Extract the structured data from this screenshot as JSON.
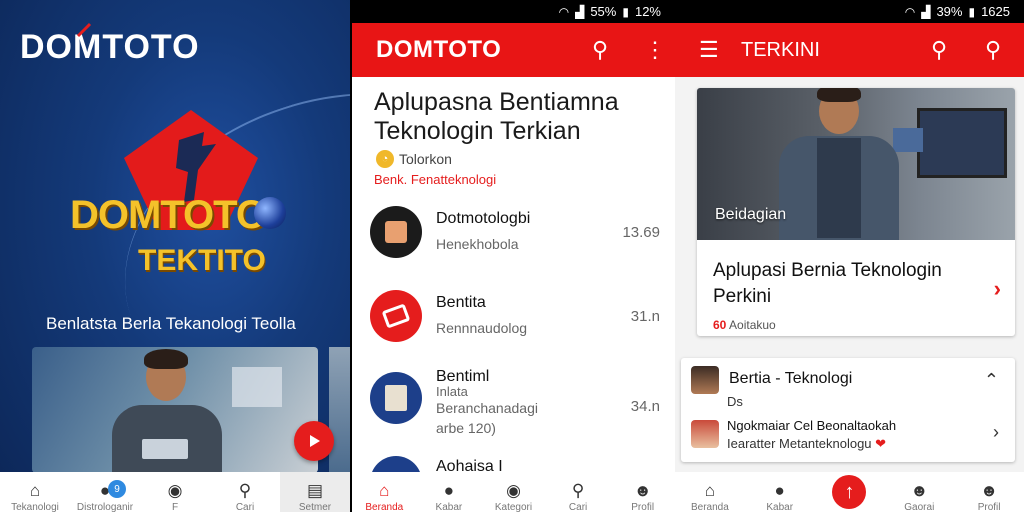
{
  "splash": {
    "logo_text": "DOMTOTO",
    "brand_big": "DOMTOTO",
    "brand_sub": "TEKTITO",
    "tagline": "Benlatsta Berla Tekanologi Teolla",
    "play_icon": "play-icon",
    "nav": [
      {
        "label": "Tekanologi",
        "icon": "home-icon"
      },
      {
        "label": "Distrologanir",
        "icon": "chat-icon",
        "badge": "9"
      },
      {
        "label": "F",
        "icon": "camera-icon"
      },
      {
        "label": "Cari",
        "icon": "search-icon"
      },
      {
        "label": "Setmer",
        "icon": "news-icon"
      }
    ]
  },
  "feed": {
    "status": {
      "battery": "55%",
      "time": "12%"
    },
    "brand": "DOMTOTO",
    "headline": "Aplupasna Bentiamna Teknologin Terkian",
    "source": "Tolorkon",
    "category": "Benk. Fenatteknologi",
    "items": [
      {
        "title": "Dotmotologbi",
        "sub": "Henekhobola",
        "time": "13.69"
      },
      {
        "title": "Bentita",
        "sub": "Rennnaudolog",
        "time": "31.n"
      },
      {
        "title": "Bentiml",
        "sub": "Beranchanadagi",
        "sub2": "arbe 120)",
        "sub_top": "Inlata",
        "time": "34.n"
      },
      {
        "title": "Aohaisa I",
        "sub": "",
        "time": ""
      }
    ],
    "nav": [
      {
        "label": "Beranda",
        "icon": "home-icon"
      },
      {
        "label": "Kabar",
        "icon": "chat-icon"
      },
      {
        "label": "Kategori",
        "icon": "camera-icon"
      },
      {
        "label": "Cari",
        "icon": "search-icon"
      },
      {
        "label": "Profil",
        "icon": "person-icon"
      }
    ]
  },
  "detail": {
    "status": {
      "battery": "39%",
      "time": "1625"
    },
    "title": "TERKINI",
    "card": {
      "photo_label": "Beidagian",
      "title": "Aplupasi Bernia Teknologin Perkini",
      "meta_prefix": "60",
      "meta": "Aoitakuo"
    },
    "mini": [
      {
        "title": "Bertia - Teknologi",
        "sub": "Ds"
      },
      {
        "title": "Ngokmaiar Cel Beonaltaokah",
        "sub": "Iearatter Metanteknologu"
      }
    ],
    "nav": [
      {
        "label": "Beranda",
        "icon": "home-icon"
      },
      {
        "label": "Kabar",
        "icon": "chat-icon"
      },
      {
        "label": "",
        "icon": "plus-icon"
      },
      {
        "label": "Gaorai",
        "icon": "people-icon"
      },
      {
        "label": "Profil",
        "icon": "person-icon"
      }
    ]
  },
  "colors": {
    "accent": "#e81515",
    "splash_bg": "#143a7a",
    "gold": "#f4c22a"
  }
}
